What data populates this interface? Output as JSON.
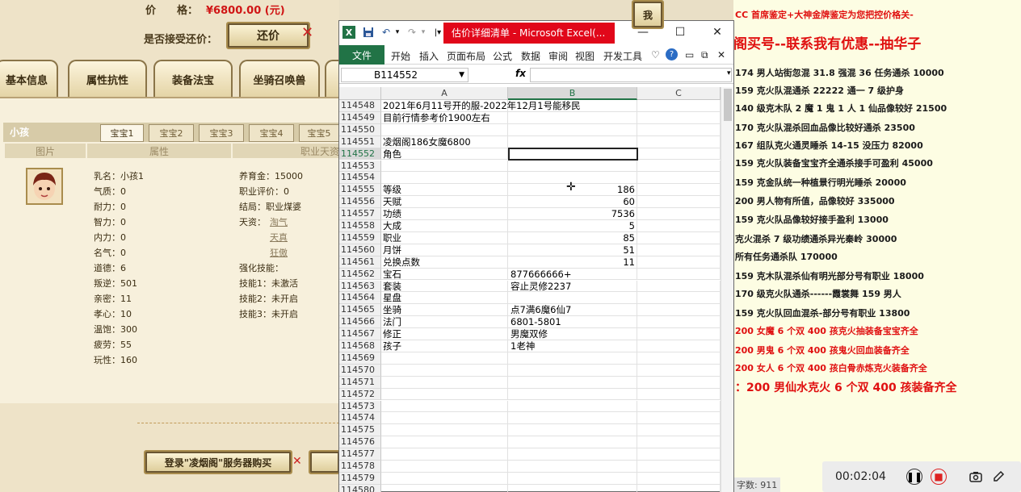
{
  "game": {
    "price_label": "价　　格：",
    "price_value": "¥6800.00 (元)",
    "accept_label": "是否接受还价：",
    "counter_button": "还价",
    "tabs": [
      "基本信息",
      "属性抗性",
      "装备法宝",
      "坐骑召唤兽"
    ],
    "char_name": "小孩",
    "baby_tabs": [
      "宝宝1",
      "宝宝2",
      "宝宝3",
      "宝宝4",
      "宝宝5"
    ],
    "col_headers": [
      "图片",
      "属性",
      "职业天资"
    ],
    "attrs_left": [
      "乳名：小孩1",
      "气质：0",
      "耐力：0",
      "智力：0",
      "内力：0",
      "名气：0",
      "道德：6",
      "叛逆：501",
      "亲密：11",
      "孝心：10",
      "温饱：300",
      "疲劳：55",
      "玩性：160"
    ],
    "attrs_right": [
      "养育金：15000",
      "职业评价：0",
      "结局：职业煤婆",
      "天资：",
      "强化技能：",
      "技能1：未激活",
      "技能2：未开启",
      "技能3：未开启"
    ],
    "talents": [
      "淘气",
      "天真",
      "狂傲"
    ],
    "bottom_button": "登录\"凌烟阁\"服务器购买",
    "top_right_button": "我"
  },
  "excel": {
    "title": "估价详细清单 - Microsoft Excel(...",
    "file_tab": "文件",
    "ribbon_tabs": [
      "开始",
      "插入",
      "页面布局",
      "公式",
      "数据",
      "审阅",
      "视图",
      "开发工具"
    ],
    "name_box": "B114552",
    "fx_symbol": "fx",
    "columns": [
      "A",
      "B",
      "C"
    ],
    "rows": [
      {
        "n": "114548",
        "a": "2021年6月11号开的服-2022年12月1号能移民",
        "b": ""
      },
      {
        "n": "114549",
        "a": "目前行情参考价1900左右",
        "b": ""
      },
      {
        "n": "114550",
        "a": "",
        "b": ""
      },
      {
        "n": "114551",
        "a": "凌烟阁186女魔6800",
        "b": ""
      },
      {
        "n": "114552",
        "a": "角色",
        "b": ""
      },
      {
        "n": "114553",
        "a": "",
        "b": ""
      },
      {
        "n": "114554",
        "a": "",
        "b": ""
      },
      {
        "n": "114555",
        "a": "等级",
        "b": "186"
      },
      {
        "n": "114556",
        "a": "天赋",
        "b": "60"
      },
      {
        "n": "114557",
        "a": "功绩",
        "b": "7536"
      },
      {
        "n": "114558",
        "a": "大成",
        "b": "5"
      },
      {
        "n": "114559",
        "a": "职业",
        "b": "85"
      },
      {
        "n": "114560",
        "a": "月饼",
        "b": "51"
      },
      {
        "n": "114561",
        "a": "兑换点数",
        "b": "11"
      },
      {
        "n": "114562",
        "a": "宝石",
        "b": "877666666+"
      },
      {
        "n": "114563",
        "a": "套装",
        "b": "容止灵修2237"
      },
      {
        "n": "114564",
        "a": "星盘",
        "b": ""
      },
      {
        "n": "114565",
        "a": "坐骑",
        "b": "点7满6魔6仙7"
      },
      {
        "n": "114566",
        "a": "法门",
        "b": "6801-5801"
      },
      {
        "n": "114567",
        "a": "修正",
        "b": "男魔双修"
      },
      {
        "n": "114568",
        "a": "孩子",
        "b": "1老神"
      },
      {
        "n": "114569",
        "a": "",
        "b": ""
      },
      {
        "n": "114570",
        "a": "",
        "b": ""
      },
      {
        "n": "114571",
        "a": "",
        "b": ""
      },
      {
        "n": "114572",
        "a": "",
        "b": ""
      },
      {
        "n": "114573",
        "a": "",
        "b": ""
      },
      {
        "n": "114574",
        "a": "",
        "b": ""
      },
      {
        "n": "114575",
        "a": "",
        "b": ""
      },
      {
        "n": "114576",
        "a": "",
        "b": ""
      },
      {
        "n": "114577",
        "a": "",
        "b": ""
      },
      {
        "n": "114578",
        "a": "",
        "b": ""
      },
      {
        "n": "114579",
        "a": "",
        "b": ""
      },
      {
        "n": "114580",
        "a": "",
        "b": ""
      }
    ]
  },
  "doc": {
    "lines": [
      {
        "t": "CC 首席鉴定+大神金牌鉴定为您把控价格关-",
        "s": "red"
      },
      {
        "t": "阁买号--联系我有优惠--抽华子",
        "s": "big"
      },
      {
        "t": "174 男人站街忽混 31.8 强混 36 任务通杀 10000",
        "s": ""
      },
      {
        "t": "159 克火队混通杀 22222 通一 7 级护身",
        "s": ""
      },
      {
        "t": "140 级克木队 2 魔 1 鬼 1 人 1 仙品像较好 21500",
        "s": ""
      },
      {
        "t": "170 克火队混杀回血品像比较好通杀 23500",
        "s": ""
      },
      {
        "t": "167 组队克火通灵睡杀 14-15 没压力 82000",
        "s": ""
      },
      {
        "t": "159 克火队装备宝宝齐全通杀接手可盈利 45000",
        "s": ""
      },
      {
        "t": "159 克金队统一种植景行明光睡杀 20000",
        "s": ""
      },
      {
        "t": "200 男人物有所值，品像较好 335000",
        "s": ""
      },
      {
        "t": "159 克火队品像较好接手盈利 13000",
        "s": ""
      },
      {
        "t": "克火混杀 7 级功绩通杀异光秦岭 30000",
        "s": ""
      },
      {
        "t": "所有任务通杀队 170000",
        "s": ""
      },
      {
        "t": "159 克木队混杀仙有明光部分号有职业 18000",
        "s": ""
      },
      {
        "t": "170 级克火队通杀------霞裳舞 159 男人",
        "s": ""
      },
      {
        "t": "159 克火队回血混杀-部分号有职业 13800",
        "s": ""
      },
      {
        "t": "200 女魔 6 个双 400 孩克火抽装备宝宝齐全",
        "s": "red"
      },
      {
        "t": "200 男鬼 6 个双 400 孩鬼火回血装备齐全",
        "s": "red"
      },
      {
        "t": "200 女人 6 个双 400 孩白骨赤炼克火装备齐全",
        "s": "red"
      },
      {
        "t": "：200 男仙水克火 6 个双 400 孩装备齐全",
        "s": "med"
      }
    ],
    "word_count": "字数: 911",
    "recorder_time": "00:02:04"
  }
}
